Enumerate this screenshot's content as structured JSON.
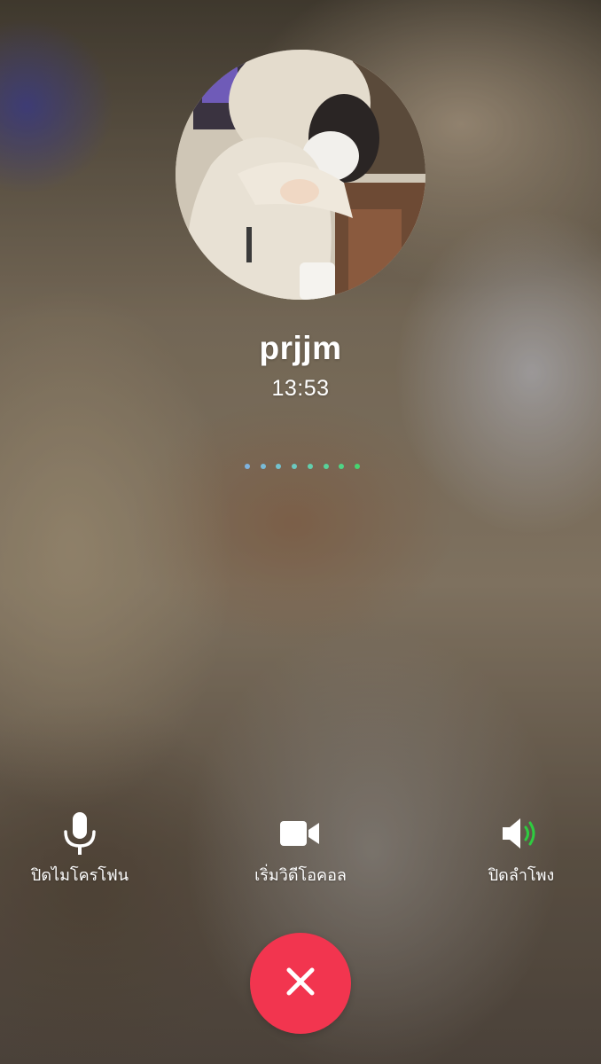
{
  "call": {
    "contact_name": "prjjm",
    "duration": "13:53"
  },
  "status_indicator": {
    "dot_colors": [
      "#7fb3e0",
      "#79bbd8",
      "#73c2cf",
      "#6cc9c0",
      "#62cfae",
      "#58d29a",
      "#4fd485",
      "#47d570"
    ]
  },
  "controls": {
    "mute": {
      "label": "ปิดไมโครโฟน",
      "icon": "microphone-icon"
    },
    "video": {
      "label": "เริ่มวิดีโอคอล",
      "icon": "video-camera-icon"
    },
    "speaker": {
      "label": "ปิดลำโพง",
      "icon": "speaker-icon",
      "active_color": "#2ecc40"
    }
  },
  "end_call": {
    "icon": "close-icon",
    "color": "#f2354f"
  }
}
